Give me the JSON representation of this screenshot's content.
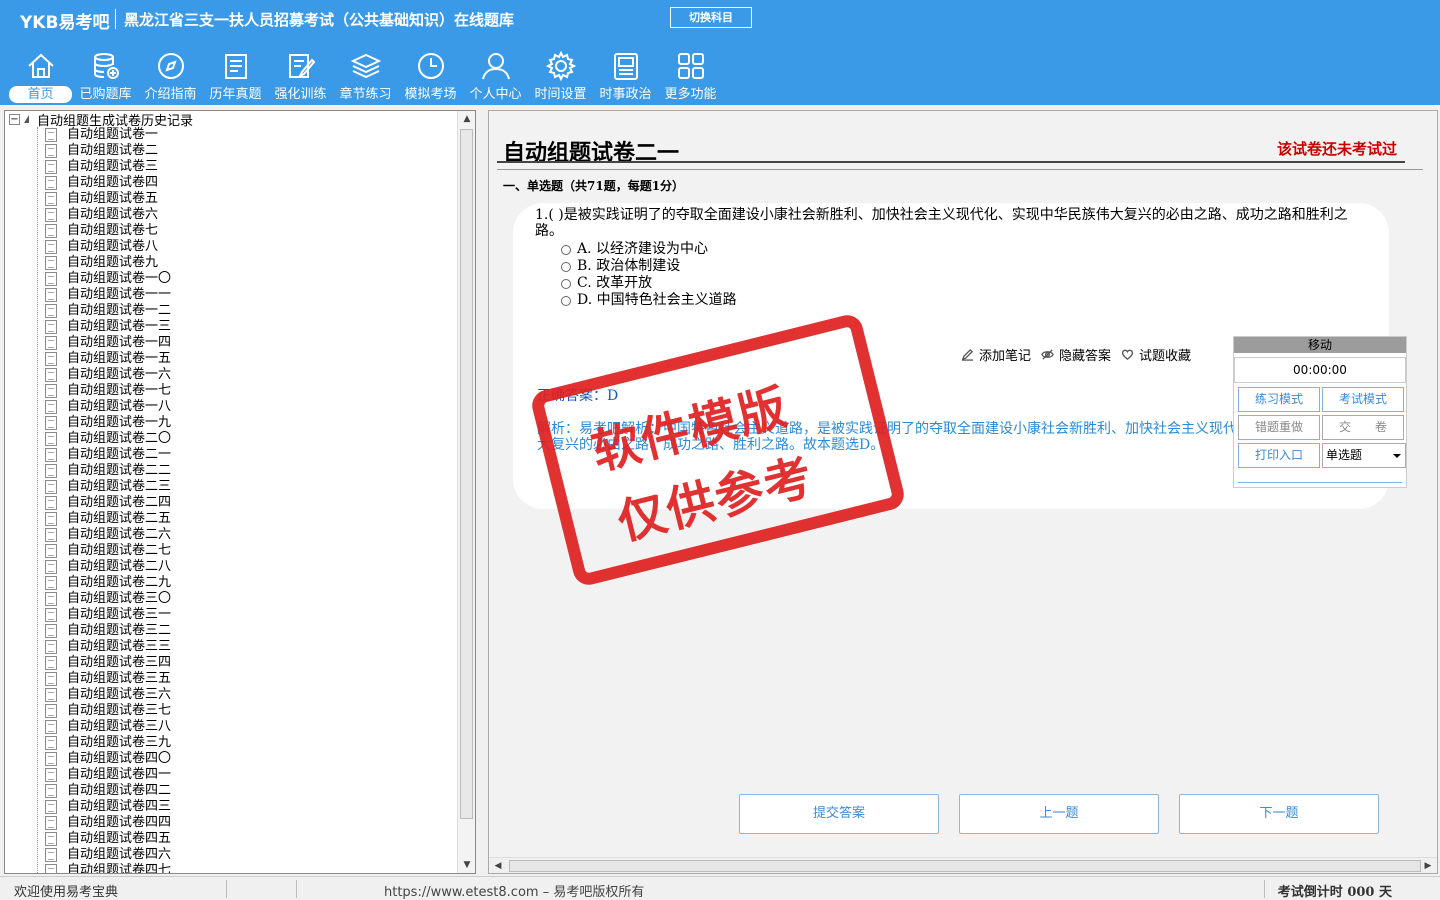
{
  "header": {
    "brand": "YKB易考吧",
    "title": "黑龙江省三支一扶人员招募考试（公共基础知识）在线题库",
    "switch_label": "切换科目"
  },
  "nav": [
    {
      "label": "首页",
      "icon": "home-icon"
    },
    {
      "label": "已购题库",
      "icon": "database-icon"
    },
    {
      "label": "介绍指南",
      "icon": "compass-icon"
    },
    {
      "label": "历年真题",
      "icon": "document-list-icon"
    },
    {
      "label": "强化训练",
      "icon": "edit-icon"
    },
    {
      "label": "章节练习",
      "icon": "layers-icon"
    },
    {
      "label": "模拟考场",
      "icon": "clock-icon"
    },
    {
      "label": "个人中心",
      "icon": "user-icon"
    },
    {
      "label": "时间设置",
      "icon": "gear-icon"
    },
    {
      "label": "时事政治",
      "icon": "newspaper-icon"
    },
    {
      "label": "更多功能",
      "icon": "grid-icon"
    }
  ],
  "tree": {
    "root_label": "自动组题生成试卷历史记录",
    "items": [
      "自动组题试卷一",
      "自动组题试卷二",
      "自动组题试卷三",
      "自动组题试卷四",
      "自动组题试卷五",
      "自动组题试卷六",
      "自动组题试卷七",
      "自动组题试卷八",
      "自动组题试卷九",
      "自动组题试卷一〇",
      "自动组题试卷一一",
      "自动组题试卷一二",
      "自动组题试卷一三",
      "自动组题试卷一四",
      "自动组题试卷一五",
      "自动组题试卷一六",
      "自动组题试卷一七",
      "自动组题试卷一八",
      "自动组题试卷一九",
      "自动组题试卷二〇",
      "自动组题试卷二一",
      "自动组题试卷二二",
      "自动组题试卷二三",
      "自动组题试卷二四",
      "自动组题试卷二五",
      "自动组题试卷二六",
      "自动组题试卷二七",
      "自动组题试卷二八",
      "自动组题试卷二九",
      "自动组题试卷三〇",
      "自动组题试卷三一",
      "自动组题试卷三二",
      "自动组题试卷三三",
      "自动组题试卷三四",
      "自动组题试卷三五",
      "自动组题试卷三六",
      "自动组题试卷三七",
      "自动组题试卷三八",
      "自动组题试卷三九",
      "自动组题试卷四〇",
      "自动组题试卷四一",
      "自动组题试卷四二",
      "自动组题试卷四三",
      "自动组题试卷四四",
      "自动组题试卷四五",
      "自动组题试卷四六",
      "自动组题试卷四七"
    ]
  },
  "paper": {
    "title": "自动组题试卷二一",
    "status": "该试卷还未考试过",
    "section": "一、单选题（共71题，每题1分）"
  },
  "question": {
    "text": "1.( )是被实践证明了的夺取全面建设小康社会新胜利、加快社会主义现代化、实现中华民族伟大复兴的必由之路、成功之路和胜利之路。",
    "options": [
      "A. 以经济建设为中心",
      "B. 政治体制建设",
      "C. 改革开放",
      "D. 中国特色社会主义道路"
    ],
    "tools": [
      "添加笔记",
      "隐藏答案",
      "试题收藏"
    ],
    "answer": "正确答案：D",
    "analysis": "解析：易考吧解析：中国特色社会主义道路，是被实践证明了的夺取全面建设小康社会新胜利、加快社会主义现代化、实现中华民族伟大复兴的必由之路、成功之路、胜利之路。故本题选D。"
  },
  "control": {
    "move": "移动",
    "timer": "00:00:00",
    "practice_mode": "练习模式",
    "exam_mode": "考试模式",
    "redo_wrong": "错题重做",
    "submit_paper": "交　　卷",
    "print_entry": "打印入口",
    "type_select": "单选题"
  },
  "watermark": {
    "line1": "软件模版",
    "line2": "仅供参考"
  },
  "buttons": {
    "submit": "提交答案",
    "prev": "上一题",
    "next": "下一题"
  },
  "statusbar": {
    "welcome": "欢迎使用易考宝典",
    "copyright": "https://www.etest8.com – 易考吧版权所有",
    "countdown": "考试倒计时 000 天"
  }
}
